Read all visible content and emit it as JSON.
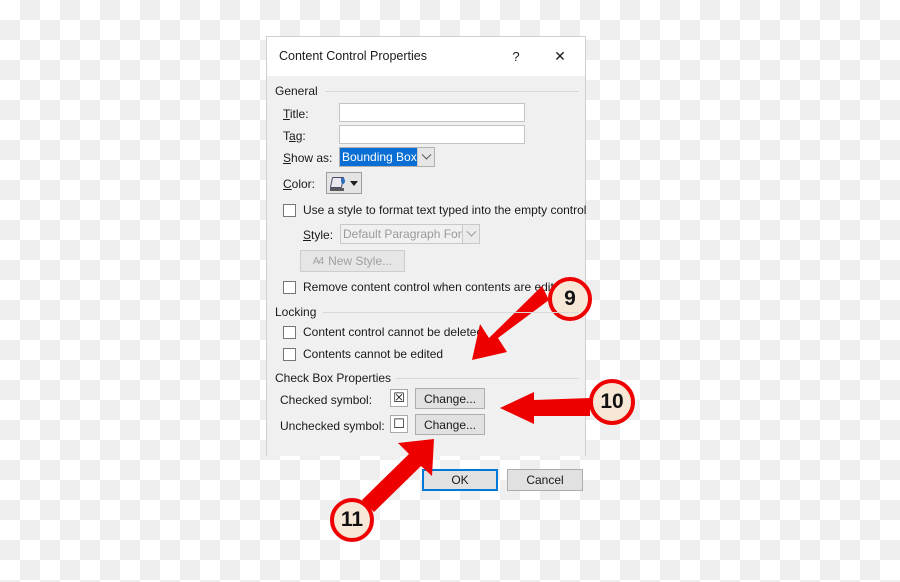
{
  "dialog": {
    "title": "Content Control Properties",
    "help_icon": "?",
    "close_icon": "✕",
    "groups": {
      "general": {
        "label": "General",
        "title_label": "Title:",
        "title_value": "",
        "tag_label": "Tag:",
        "tag_value": "",
        "show_as_label": "Show as:",
        "show_as_value": "Bounding Box",
        "color_label": "Color:",
        "use_style_label": "Use a style to format text typed into the empty control",
        "use_style_checked": false,
        "style_label": "Style:",
        "style_value": "Default Paragraph Font",
        "new_style_label": "New Style...",
        "remove_control_label": "Remove content control when contents are edited",
        "remove_control_checked": false
      },
      "locking": {
        "label": "Locking",
        "cannot_delete_label": "Content control cannot be deleted",
        "cannot_delete_checked": false,
        "cannot_edit_label": "Contents cannot be edited",
        "cannot_edit_checked": false
      },
      "checkbox_props": {
        "label": "Check Box Properties",
        "checked_symbol_label": "Checked symbol:",
        "checked_symbol_glyph": "☒",
        "checked_change_label": "Change...",
        "unchecked_symbol_label": "Unchecked symbol:",
        "unchecked_symbol_glyph": "☐",
        "unchecked_change_label": "Change..."
      }
    },
    "footer": {
      "ok_label": "OK",
      "cancel_label": "Cancel"
    }
  },
  "annotations": {
    "arrow_color": "#ee0000",
    "callout_fill": "#f7e7d7",
    "callouts": [
      {
        "number": "9"
      },
      {
        "number": "10"
      },
      {
        "number": "11"
      }
    ]
  }
}
